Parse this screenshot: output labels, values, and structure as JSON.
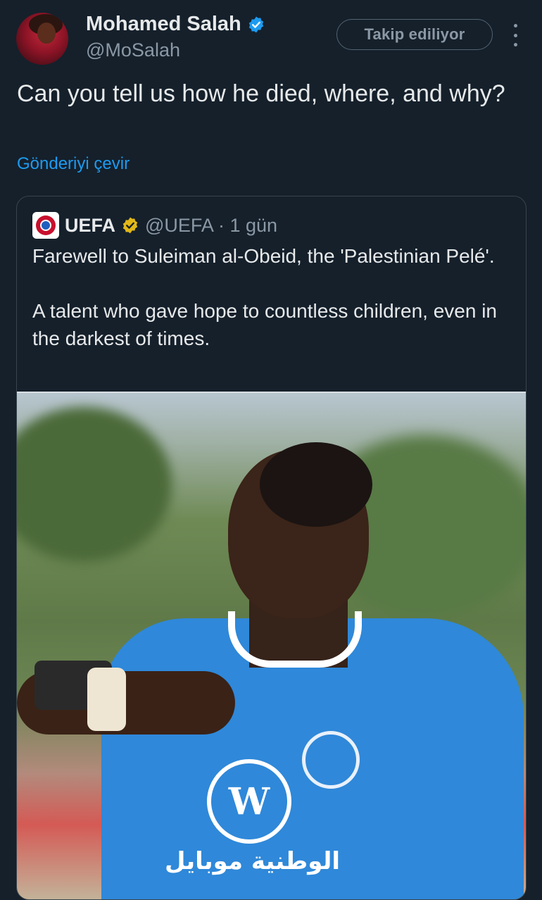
{
  "author": {
    "name": "Mohamed Salah",
    "handle": "@MoSalah",
    "follow_label": "Takip ediliyor"
  },
  "tweet": {
    "text": "Can you tell us how he died, where, and why?",
    "translate_label": "Gönderiyi çevir"
  },
  "quoted": {
    "name": "UEFA",
    "handle": "@UEFA",
    "time": "· 1 gün",
    "paragraph1": "Farewell to Suleiman al-Obeid, the 'Palestinian Pelé'.",
    "paragraph2": "A talent who gave hope to countless children, even in the darkest of times.",
    "media": {
      "shirt_logo": "W",
      "sponsor_text": "الوطنية موبايل"
    }
  },
  "colors": {
    "background": "#15202b",
    "accent": "#1d9bf0",
    "verified_blue": "#1d9bf0",
    "verified_gold": "#e2b719"
  },
  "icons": {
    "verified": "verified-badge-icon",
    "gold_verified": "gold-verified-badge-icon",
    "more": "more-options-icon"
  }
}
